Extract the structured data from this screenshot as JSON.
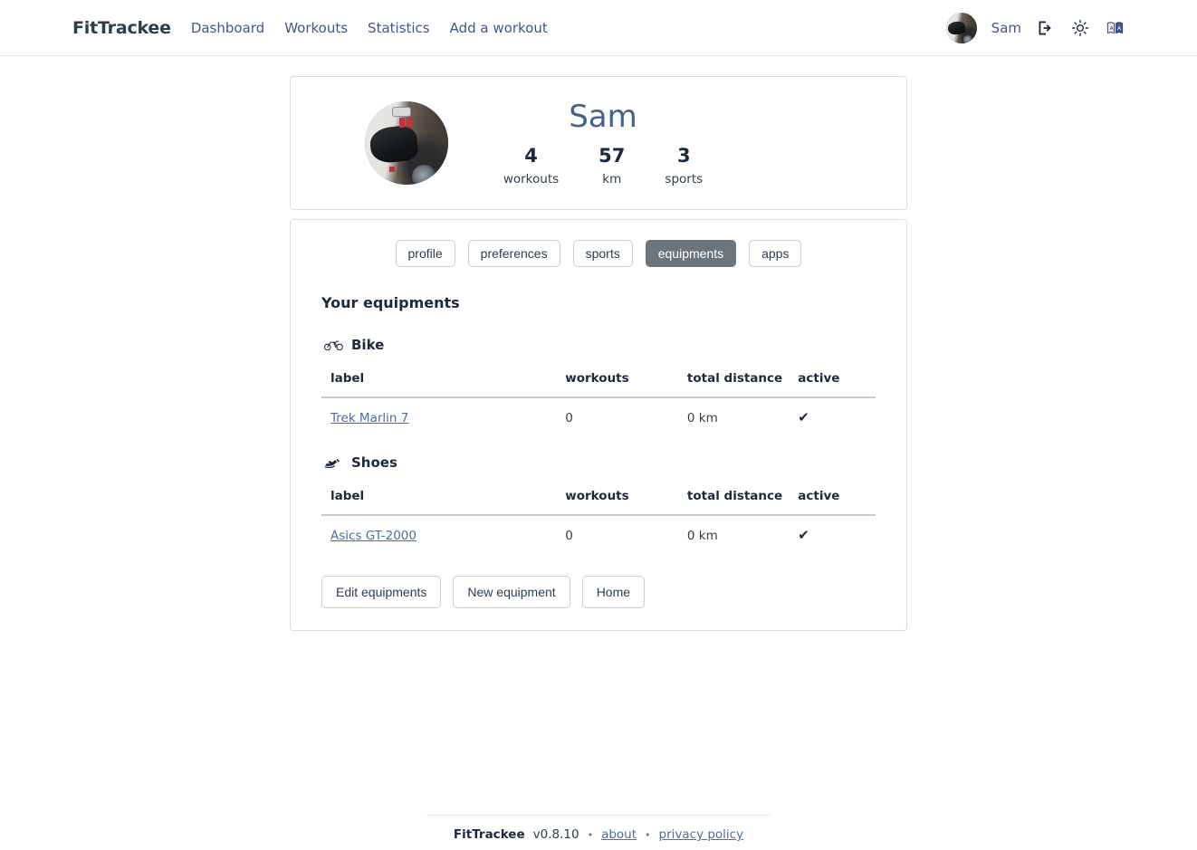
{
  "header": {
    "brand": "FitTrackee",
    "nav": [
      {
        "label": "Dashboard",
        "name": "nav-dashboard"
      },
      {
        "label": "Workouts",
        "name": "nav-workouts"
      },
      {
        "label": "Statistics",
        "name": "nav-statistics"
      },
      {
        "label": "Add a workout",
        "name": "nav-add-workout"
      }
    ],
    "user": "Sam",
    "icons": {
      "avatar": "user-avatar",
      "logout": "logout-icon",
      "theme": "sun-icon",
      "language": "language-icon"
    }
  },
  "profile": {
    "name": "Sam",
    "avatar_alt": "user-avatar",
    "stats": [
      {
        "value": "4",
        "label": "workouts"
      },
      {
        "value": "57",
        "label": "km"
      },
      {
        "value": "3",
        "label": "sports"
      }
    ]
  },
  "tabs": [
    {
      "label": "profile",
      "active": false
    },
    {
      "label": "preferences",
      "active": false
    },
    {
      "label": "sports",
      "active": false
    },
    {
      "label": "equipments",
      "active": true
    },
    {
      "label": "apps",
      "active": false
    }
  ],
  "equipments": {
    "title": "Your equipments",
    "columns": [
      "label",
      "workouts",
      "total distance",
      "active"
    ],
    "groups": [
      {
        "name": "Bike",
        "icon": "bicycle-icon",
        "rows": [
          {
            "label": "Trek Marlin 7",
            "workouts": "0",
            "distance": "0 km",
            "active": "✔"
          }
        ]
      },
      {
        "name": "Shoes",
        "icon": "shoe-icon",
        "rows": [
          {
            "label": "Asics GT-2000",
            "workouts": "0",
            "distance": "0 km",
            "active": "✔"
          }
        ]
      }
    ],
    "actions": [
      {
        "label": "Edit equipments",
        "name": "edit-equipments-button"
      },
      {
        "label": "New equipment",
        "name": "new-equipment-button"
      },
      {
        "label": "Home",
        "name": "home-button"
      }
    ]
  },
  "footer": {
    "brand": "FitTrackee",
    "version": "v0.8.10",
    "separator": "•",
    "about": "about",
    "privacy": "privacy policy"
  },
  "colors": {
    "accent_blue": "#40578a",
    "link_blue": "#4a6fa5",
    "active_tab_bg": "#6c757d",
    "heading_navy": "#1b2a41",
    "border_gray": "#dcdce3"
  }
}
